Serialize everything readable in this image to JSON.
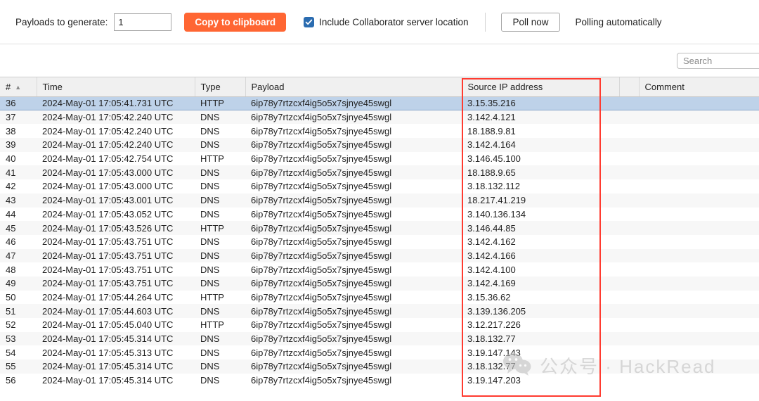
{
  "toolbar": {
    "payloads_label": "Payloads to generate:",
    "payloads_value": "1",
    "copy_button": "Copy to clipboard",
    "include_location_label": "Include Collaborator server location",
    "include_location_checked": true,
    "poll_now_button": "Poll now",
    "polling_status": "Polling automatically",
    "accent_color": "#ff6633",
    "checkbox_color": "#2b6cb0"
  },
  "search": {
    "placeholder": "Search",
    "value": ""
  },
  "table": {
    "columns": [
      {
        "key": "num",
        "label": "#",
        "sort": "asc"
      },
      {
        "key": "time",
        "label": "Time"
      },
      {
        "key": "type",
        "label": "Type"
      },
      {
        "key": "payload",
        "label": "Payload"
      },
      {
        "key": "ip",
        "label": "Source IP address"
      },
      {
        "key": "gap",
        "label": ""
      },
      {
        "key": "comment",
        "label": "Comment"
      }
    ],
    "selected_row_index": 0,
    "rows": [
      {
        "num": "36",
        "time": "2024-May-01 17:05:41.731 UTC",
        "type": "HTTP",
        "payload": "6ip78y7rtzcxf4ig5o5x7sjnye45swgl",
        "ip": "3.15.35.216",
        "comment": ""
      },
      {
        "num": "37",
        "time": "2024-May-01 17:05:42.240 UTC",
        "type": "DNS",
        "payload": "6ip78y7rtzcxf4ig5o5x7sjnye45swgl",
        "ip": "3.142.4.121",
        "comment": ""
      },
      {
        "num": "38",
        "time": "2024-May-01 17:05:42.240 UTC",
        "type": "DNS",
        "payload": "6ip78y7rtzcxf4ig5o5x7sjnye45swgl",
        "ip": "18.188.9.81",
        "comment": ""
      },
      {
        "num": "39",
        "time": "2024-May-01 17:05:42.240 UTC",
        "type": "DNS",
        "payload": "6ip78y7rtzcxf4ig5o5x7sjnye45swgl",
        "ip": "3.142.4.164",
        "comment": ""
      },
      {
        "num": "40",
        "time": "2024-May-01 17:05:42.754 UTC",
        "type": "HTTP",
        "payload": "6ip78y7rtzcxf4ig5o5x7sjnye45swgl",
        "ip": "3.146.45.100",
        "comment": ""
      },
      {
        "num": "41",
        "time": "2024-May-01 17:05:43.000 UTC",
        "type": "DNS",
        "payload": "6ip78y7rtzcxf4ig5o5x7sjnye45swgl",
        "ip": "18.188.9.65",
        "comment": ""
      },
      {
        "num": "42",
        "time": "2024-May-01 17:05:43.000 UTC",
        "type": "DNS",
        "payload": "6ip78y7rtzcxf4ig5o5x7sjnye45swgl",
        "ip": "3.18.132.112",
        "comment": ""
      },
      {
        "num": "43",
        "time": "2024-May-01 17:05:43.001 UTC",
        "type": "DNS",
        "payload": "6ip78y7rtzcxf4ig5o5x7sjnye45swgl",
        "ip": "18.217.41.219",
        "comment": ""
      },
      {
        "num": "44",
        "time": "2024-May-01 17:05:43.052 UTC",
        "type": "DNS",
        "payload": "6ip78y7rtzcxf4ig5o5x7sjnye45swgl",
        "ip": "3.140.136.134",
        "comment": ""
      },
      {
        "num": "45",
        "time": "2024-May-01 17:05:43.526 UTC",
        "type": "HTTP",
        "payload": "6ip78y7rtzcxf4ig5o5x7sjnye45swgl",
        "ip": "3.146.44.85",
        "comment": ""
      },
      {
        "num": "46",
        "time": "2024-May-01 17:05:43.751 UTC",
        "type": "DNS",
        "payload": "6ip78y7rtzcxf4ig5o5x7sjnye45swgl",
        "ip": "3.142.4.162",
        "comment": ""
      },
      {
        "num": "47",
        "time": "2024-May-01 17:05:43.751 UTC",
        "type": "DNS",
        "payload": "6ip78y7rtzcxf4ig5o5x7sjnye45swgl",
        "ip": "3.142.4.166",
        "comment": ""
      },
      {
        "num": "48",
        "time": "2024-May-01 17:05:43.751 UTC",
        "type": "DNS",
        "payload": "6ip78y7rtzcxf4ig5o5x7sjnye45swgl",
        "ip": "3.142.4.100",
        "comment": ""
      },
      {
        "num": "49",
        "time": "2024-May-01 17:05:43.751 UTC",
        "type": "DNS",
        "payload": "6ip78y7rtzcxf4ig5o5x7sjnye45swgl",
        "ip": "3.142.4.169",
        "comment": ""
      },
      {
        "num": "50",
        "time": "2024-May-01 17:05:44.264 UTC",
        "type": "HTTP",
        "payload": "6ip78y7rtzcxf4ig5o5x7sjnye45swgl",
        "ip": "3.15.36.62",
        "comment": ""
      },
      {
        "num": "51",
        "time": "2024-May-01 17:05:44.603 UTC",
        "type": "DNS",
        "payload": "6ip78y7rtzcxf4ig5o5x7sjnye45swgl",
        "ip": "3.139.136.205",
        "comment": ""
      },
      {
        "num": "52",
        "time": "2024-May-01 17:05:45.040 UTC",
        "type": "HTTP",
        "payload": "6ip78y7rtzcxf4ig5o5x7sjnye45swgl",
        "ip": "3.12.217.226",
        "comment": ""
      },
      {
        "num": "53",
        "time": "2024-May-01 17:05:45.314 UTC",
        "type": "DNS",
        "payload": "6ip78y7rtzcxf4ig5o5x7sjnye45swgl",
        "ip": "3.18.132.77",
        "comment": ""
      },
      {
        "num": "54",
        "time": "2024-May-01 17:05:45.313 UTC",
        "type": "DNS",
        "payload": "6ip78y7rtzcxf4ig5o5x7sjnye45swgl",
        "ip": "3.19.147.143",
        "comment": ""
      },
      {
        "num": "55",
        "time": "2024-May-01 17:05:45.314 UTC",
        "type": "DNS",
        "payload": "6ip78y7rtzcxf4ig5o5x7sjnye45swgl",
        "ip": "3.18.132.77",
        "comment": ""
      },
      {
        "num": "56",
        "time": "2024-May-01 17:05:45.314 UTC",
        "type": "DNS",
        "payload": "6ip78y7rtzcxf4ig5o5x7sjnye45swgl",
        "ip": "3.19.147.203",
        "comment": ""
      }
    ]
  },
  "annotation": {
    "color": "#ff3b30",
    "highlights_column": "Source IP address"
  },
  "watermark": {
    "icon": "wechat-icon",
    "text": "公众号 · HackRead",
    "color": "#c2c2c2"
  }
}
